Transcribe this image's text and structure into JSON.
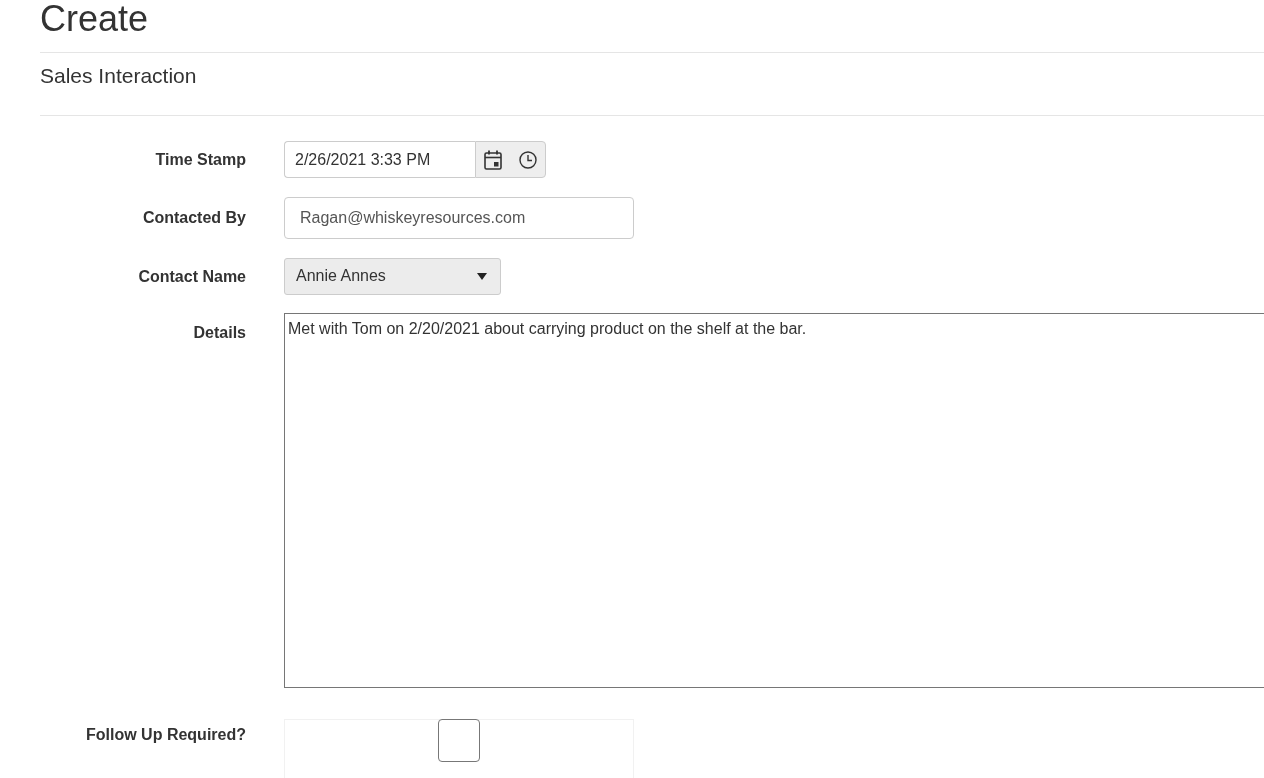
{
  "page": {
    "title": "Create",
    "subtitle": "Sales Interaction"
  },
  "form": {
    "fields": [
      {
        "kind": "datetime",
        "label": "Time Stamp",
        "value": "2/26/2021 3:33 PM"
      },
      {
        "kind": "text",
        "label": "Contacted By",
        "value": "Ragan@whiskeyresources.com"
      },
      {
        "kind": "select",
        "label": "Contact Name",
        "value": "Annie Annes"
      },
      {
        "kind": "textarea",
        "label": "Details",
        "value": "Met with Tom on 2/20/2021 about carrying product on the shelf at the bar."
      },
      {
        "kind": "checkbox",
        "label": "Follow Up Required?",
        "checked": false
      }
    ]
  }
}
